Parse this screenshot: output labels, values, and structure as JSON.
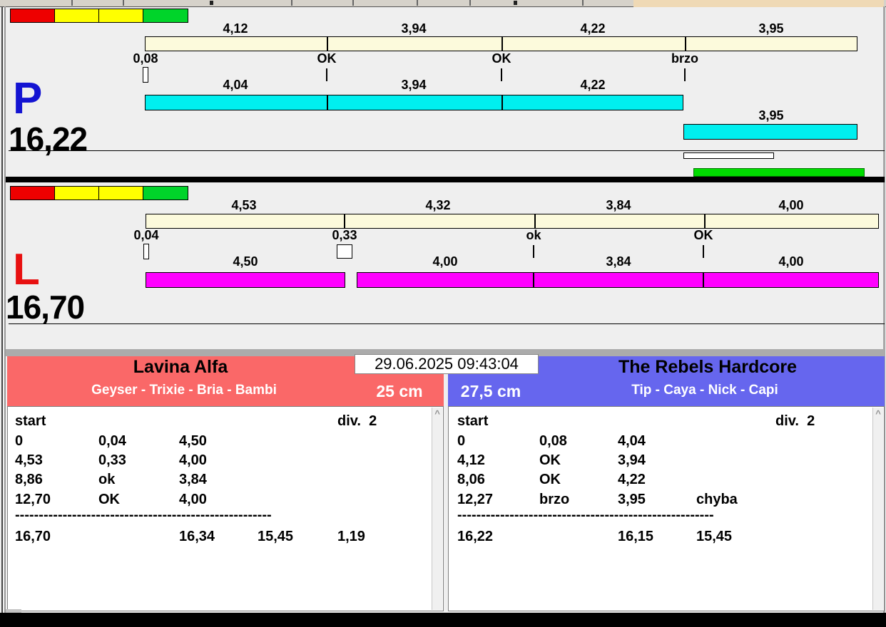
{
  "lanes": {
    "p": {
      "id": "P",
      "total": "16,22",
      "reference_splits": [
        "4,12",
        "3,94",
        "4,22",
        "3,95"
      ],
      "change_marks": [
        "0,08",
        "OK",
        "OK",
        "brzo"
      ],
      "run_splits": [
        "4,04",
        "3,94",
        "4,22"
      ],
      "run_split_last": "3,95"
    },
    "l": {
      "id": "L",
      "total": "16,70",
      "reference_splits": [
        "4,53",
        "4,32",
        "3,84",
        "4,00"
      ],
      "change_marks": [
        "0,04",
        "0,33",
        "ok",
        "OK"
      ],
      "run_splits": [
        "4,50",
        "4,00",
        "3,84",
        "4,00"
      ]
    }
  },
  "timestamp": "29.06.2025 09:43:04",
  "panels": {
    "left": {
      "name": "Lavina Alfa",
      "dogs": "Geyser - Trixie - Bria - Bambi",
      "height": "25 cm",
      "table": {
        "header_left": "start",
        "header_right": "div.  2",
        "rows": [
          [
            "0",
            "0,04",
            "4,50",
            ""
          ],
          [
            "4,53",
            "0,33",
            "4,00",
            ""
          ],
          [
            "8,86",
            "ok",
            "3,84",
            ""
          ],
          [
            "12,70",
            "OK",
            "4,00",
            ""
          ]
        ],
        "separator": "------------------------------------------------------",
        "totals": [
          "16,70",
          "16,34",
          "15,45",
          "1,19"
        ]
      }
    },
    "right": {
      "name": "The Rebels Hardcore",
      "dogs": "Tip - Caya - Nick - Capi",
      "height": "27,5 cm",
      "table": {
        "header_left": "start",
        "header_right": "div.  2",
        "rows": [
          [
            "0",
            "0,08",
            "4,04",
            ""
          ],
          [
            "4,12",
            "OK",
            "3,94",
            ""
          ],
          [
            "8,06",
            "OK",
            "4,22",
            ""
          ],
          [
            "12,27",
            "brzo",
            "3,95",
            "chyba"
          ]
        ],
        "separator": "------------------------------------------------------",
        "totals": [
          "16,22",
          "16,15",
          "15,45",
          ""
        ]
      }
    }
  },
  "scrollbar": {
    "up_glyph": "^"
  },
  "colors": {
    "background": "#EFEFEF",
    "reference_bar": "#FCFADC",
    "p_run_bar": "#00EFEF",
    "l_run_bar": "#FF00FF",
    "p_letter": "#1414D2",
    "l_letter": "#E81010",
    "traffic": [
      "#EE0000",
      "#FFFF00",
      "#FFFF00",
      "#00D42A"
    ],
    "green_bar": "#00DC00",
    "left_header": "#FA6868",
    "right_header": "#6666EE",
    "top_right_patch": "#EFD9B5"
  }
}
